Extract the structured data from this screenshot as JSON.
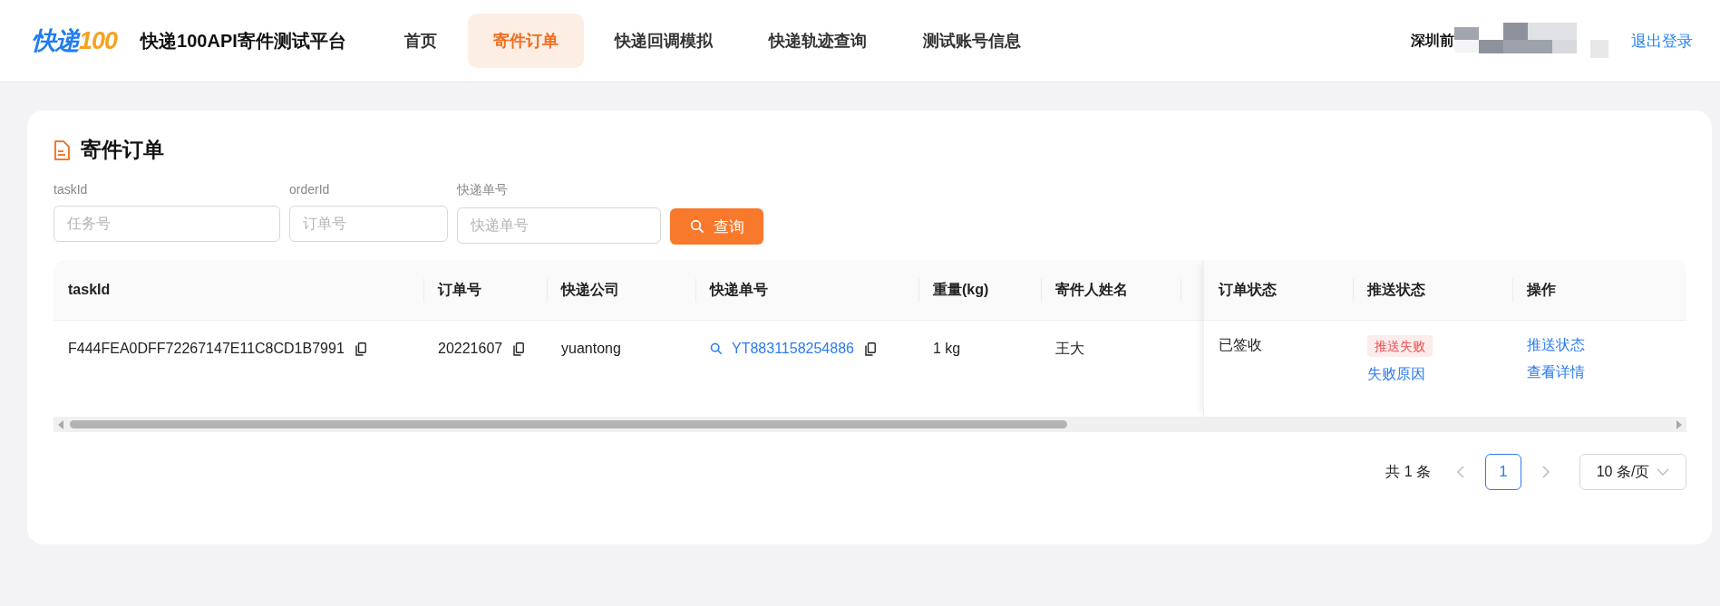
{
  "header": {
    "logo": [
      "快递",
      "100"
    ],
    "title": "快递100API寄件测试平台",
    "nav": [
      {
        "label": "首页",
        "selected": false
      },
      {
        "label": "寄件订单",
        "selected": true
      },
      {
        "label": "快递回调模拟",
        "selected": false
      },
      {
        "label": "快递轨迹查询",
        "selected": false
      },
      {
        "label": "测试账号信息",
        "selected": false
      }
    ],
    "user": "深圳前",
    "logout": "退出登录"
  },
  "page": {
    "title": "寄件订单",
    "filters": [
      {
        "label": "taskId",
        "placeholder": "任务号"
      },
      {
        "label": "orderId",
        "placeholder": "订单号"
      },
      {
        "label": "快递单号",
        "placeholder": "快递单号"
      }
    ],
    "search_button": "查询"
  },
  "table": {
    "columns": [
      "taskId",
      "订单号",
      "快递公司",
      "快递单号",
      "重量(kg)",
      "寄件人姓名"
    ],
    "fixed_columns": [
      "订单状态",
      "推送状态",
      "操作"
    ],
    "rows": [
      {
        "cells": [
          {
            "kind": "copy",
            "text": "F444FEA0DFF72267147E11C8CD1B7991"
          },
          {
            "kind": "copy",
            "text": "20221607"
          },
          {
            "kind": "text",
            "text": "yuantong"
          },
          {
            "kind": "link",
            "text": "YT8831158254886"
          },
          {
            "kind": "text",
            "text": "1 kg"
          },
          {
            "kind": "text",
            "text": "王大"
          }
        ],
        "fixed_cells": [
          {
            "kind": "text",
            "text": "已签收"
          },
          {
            "kind": "status",
            "badge": "推送失败",
            "link": "失败原因"
          },
          {
            "kind": "actions",
            "links": [
              "推送状态",
              "查看详情"
            ]
          }
        ]
      }
    ]
  },
  "pagination": {
    "total": "共 1 条",
    "pages": [
      {
        "label": "1",
        "selected": true
      }
    ],
    "page_size": "10 条/页"
  }
}
